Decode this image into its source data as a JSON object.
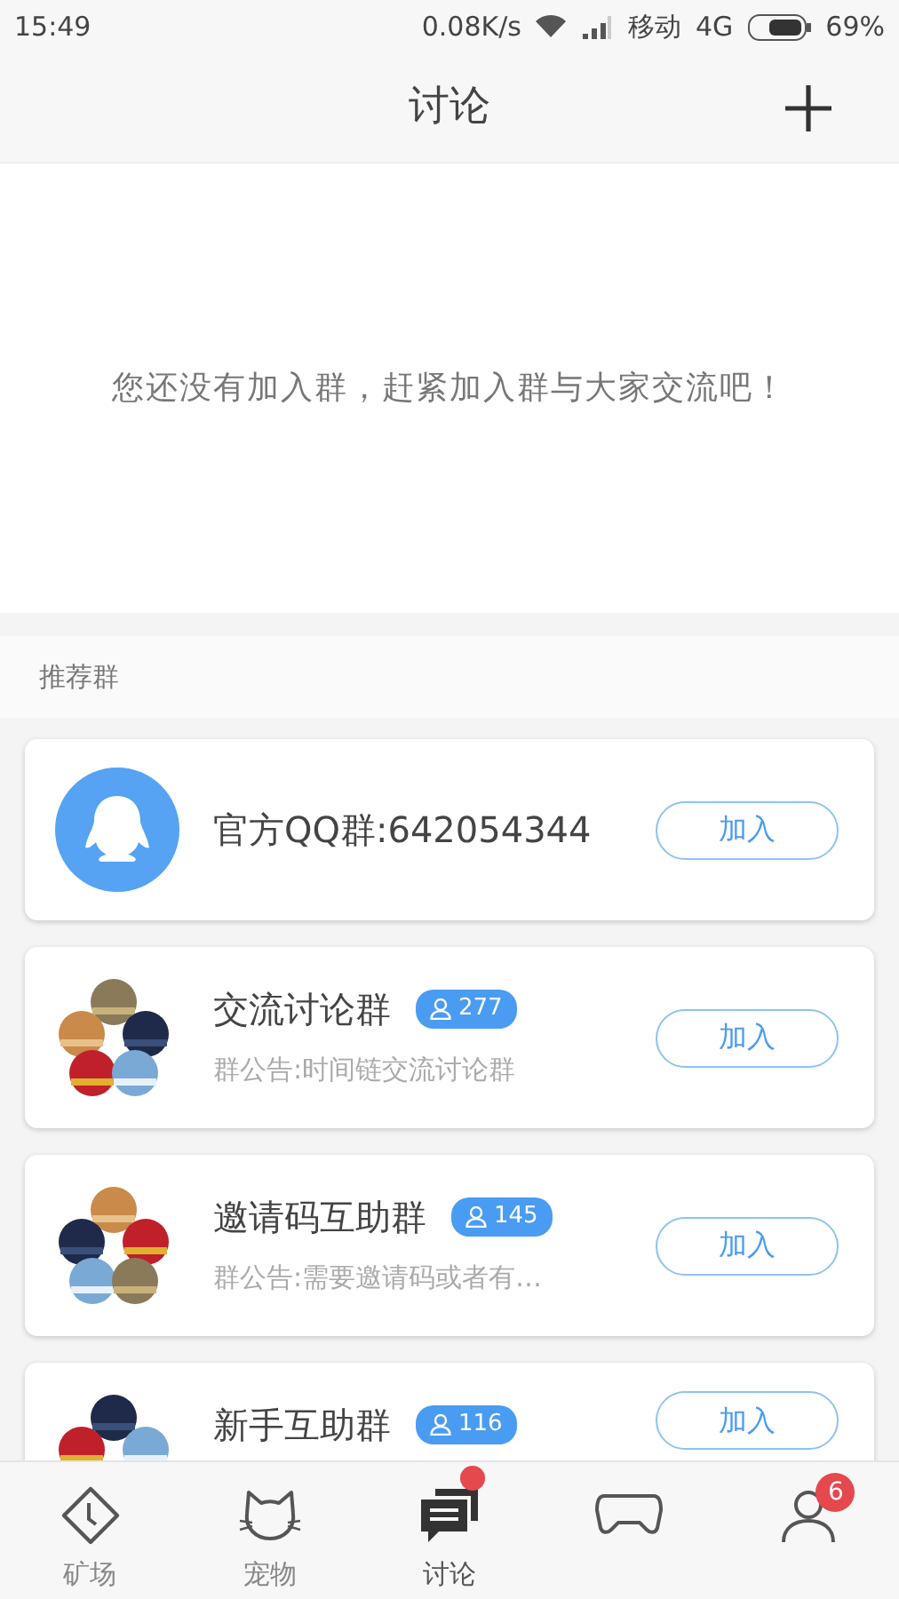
{
  "status_bar": {
    "time": "15:49",
    "speed": "0.08K/s",
    "carrier": "移动",
    "network": "4G",
    "battery": "69%"
  },
  "header": {
    "title": "讨论"
  },
  "empty_message": "您还没有加入群，赶紧加入群与大家交流吧！",
  "section_title": "推荐群",
  "groups": [
    {
      "kind": "official",
      "name": "官方QQ群:642054344",
      "button": "加入"
    },
    {
      "kind": "group",
      "name": "交流讨论群",
      "members": "277",
      "notice": "群公告:时间链交流讨论群",
      "button": "加入"
    },
    {
      "kind": "group",
      "name": "邀请码互助群",
      "members": "145",
      "notice": "群公告:需要邀请码或者有…",
      "button": "加入"
    },
    {
      "kind": "group",
      "name": "新手互助群",
      "members": "116",
      "button": "加入"
    }
  ],
  "tabs": [
    {
      "label": "矿场",
      "selected": false
    },
    {
      "label": "宠物",
      "selected": false
    },
    {
      "label": "讨论",
      "selected": true,
      "dot": true
    },
    {
      "selected": false
    },
    {
      "selected": false,
      "badge": "6"
    }
  ]
}
